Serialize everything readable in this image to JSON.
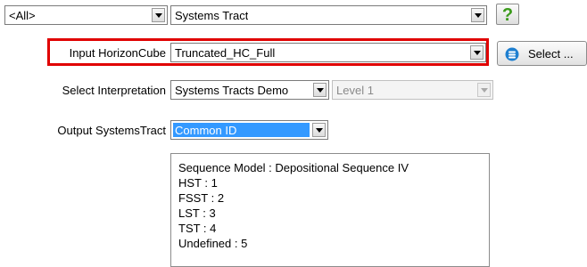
{
  "filter_row": {
    "scope_value": "<All>",
    "type_value": "Systems Tract"
  },
  "input_horizon": {
    "label": "Input HorizonCube",
    "value": "Truncated_HC_Full",
    "select_button": "Select ..."
  },
  "interpretation": {
    "label": "Select Interpretation",
    "value": "Systems Tracts Demo",
    "level_value": "Level 1"
  },
  "output": {
    "label": "Output SystemsTract",
    "value": "Common ID"
  },
  "info_box": {
    "lines": [
      "Sequence Model : Depositional Sequence IV",
      "HST : 1",
      "FSST : 2",
      "LST : 3",
      "TST : 4",
      "Undefined : 5"
    ]
  },
  "icons": {
    "help": "help-question-icon",
    "select": "database-icon"
  },
  "colors": {
    "highlight_border": "#e00000",
    "selected_bg": "#3399ff",
    "help_green": "#3a9a1a",
    "select_icon_blue": "#1e7fd0"
  }
}
